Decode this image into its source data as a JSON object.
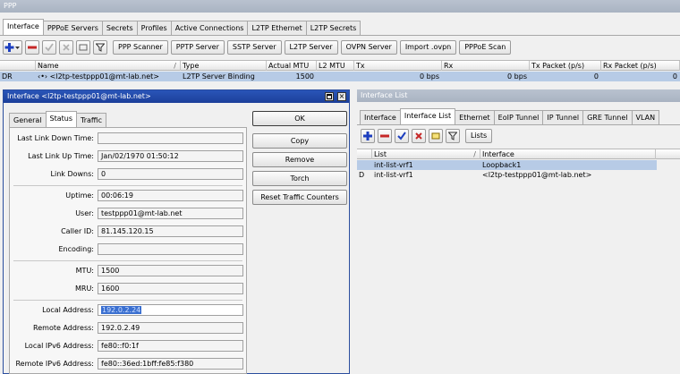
{
  "ppp": {
    "title": "PPP",
    "tabs": [
      "Interface",
      "PPPoE Servers",
      "Secrets",
      "Profiles",
      "Active Connections",
      "L2TP Ethernet",
      "L2TP Secrets"
    ],
    "toolbar": [
      "PPP Scanner",
      "PPTP Server",
      "SSTP Server",
      "L2TP Server",
      "OVPN Server",
      "Import .ovpn",
      "PPPoE Scan"
    ],
    "columns": [
      "Name",
      "Type",
      "Actual MTU",
      "L2 MTU",
      "Tx",
      "Rx",
      "Tx Packet (p/s)",
      "Rx Packet (p/s)"
    ],
    "rows": [
      {
        "flag": "DR",
        "name": "‹•› <l2tp-testppp01@mt-lab.net>",
        "type": "L2TP Server Binding",
        "actual_mtu": "1500",
        "l2_mtu": "",
        "tx": "0 bps",
        "rx": "0 bps",
        "tx_pps": "0",
        "rx_pps": "0"
      }
    ]
  },
  "interface_window": {
    "title": "Interface <l2tp-testppp01@mt-lab.net>",
    "tabs": [
      "General",
      "Status",
      "Traffic"
    ],
    "fields": {
      "last_link_down": {
        "label": "Last Link Down Time:",
        "value": ""
      },
      "last_link_up": {
        "label": "Last Link Up Time:",
        "value": "Jan/02/1970 01:50:12"
      },
      "link_downs": {
        "label": "Link Downs:",
        "value": "0"
      },
      "uptime": {
        "label": "Uptime:",
        "value": "00:06:19"
      },
      "user": {
        "label": "User:",
        "value": "testppp01@mt-lab.net"
      },
      "caller_id": {
        "label": "Caller ID:",
        "value": "81.145.120.15"
      },
      "encoding": {
        "label": "Encoding:",
        "value": ""
      },
      "mtu": {
        "label": "MTU:",
        "value": "1500"
      },
      "mru": {
        "label": "MRU:",
        "value": "1600"
      },
      "local_address": {
        "label": "Local Address:",
        "value": "192.0.2.24"
      },
      "remote_address": {
        "label": "Remote Address:",
        "value": "192.0.2.49"
      },
      "local_ipv6": {
        "label": "Local IPv6 Address:",
        "value": "fe80::f0:1f"
      },
      "remote_ipv6": {
        "label": "Remote IPv6 Address:",
        "value": "fe80::36ed:1bff:fe85:f380"
      }
    },
    "buttons": [
      "OK",
      "Copy",
      "Remove",
      "Torch",
      "Reset Traffic Counters"
    ]
  },
  "interface_list": {
    "title": "Interface List",
    "tabs": [
      "Interface",
      "Interface List",
      "Ethernet",
      "EoIP Tunnel",
      "IP Tunnel",
      "GRE Tunnel",
      "VLAN"
    ],
    "lists_button": "Lists",
    "columns": [
      "List",
      "Interface"
    ],
    "rows": [
      {
        "flag": "",
        "list": "int-list-vrf1",
        "interface": "Loopback1"
      },
      {
        "flag": "D",
        "list": "int-list-vrf1",
        "interface": "<l2tp-testppp01@mt-lab.net>"
      }
    ]
  },
  "colors": {
    "accent": "#2a55b8",
    "selection": "#b7cbe6",
    "add": "#1d3fbf",
    "remove": "#c62828"
  }
}
